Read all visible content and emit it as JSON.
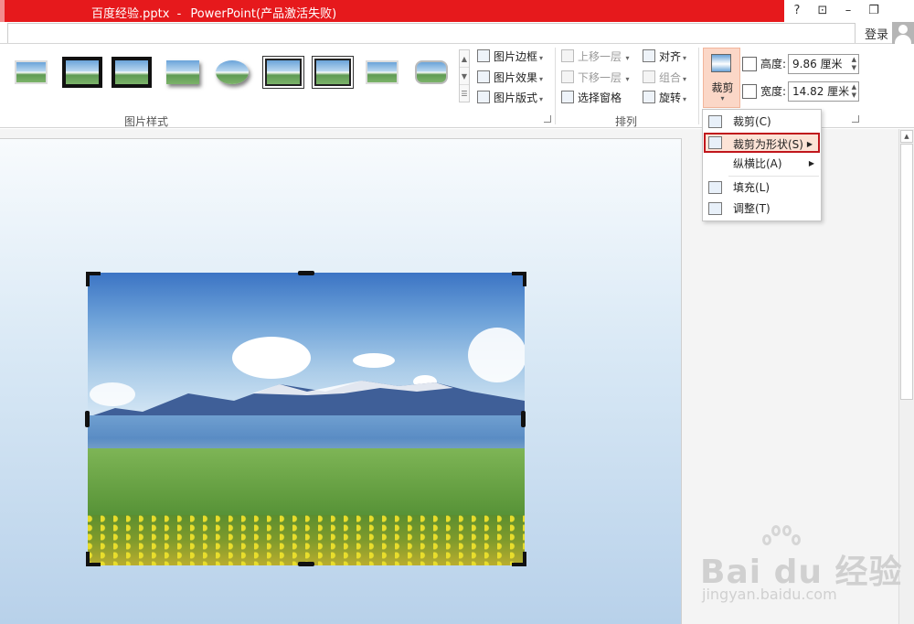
{
  "window": {
    "filename": "百度经验.pptx",
    "separator": "-",
    "app": "PowerPoint(产品激活失败)",
    "help": "?",
    "ribbon_display": "⊡",
    "minimize": "–",
    "restore": "❐",
    "login": "登录"
  },
  "picture_styles": {
    "group_label": "图片样式",
    "commands": {
      "border": "图片边框",
      "effects": "图片效果",
      "layout": "图片版式"
    }
  },
  "arrange": {
    "group_label": "排列",
    "bring_forward": "上移一层",
    "send_backward": "下移一层",
    "selection_pane": "选择窗格",
    "align": "对齐",
    "group": "组合",
    "rotate": "旋转"
  },
  "size": {
    "crop_label": "裁剪",
    "height_label": "高度:",
    "height_value": "9.86 厘米",
    "width_label": "宽度:",
    "width_value": "14.82 厘米"
  },
  "crop_menu": {
    "items": [
      {
        "label": "裁剪(C)",
        "icon": "crop-icon"
      },
      {
        "label": "裁剪为形状(S)",
        "icon": "crop-to-shape-icon",
        "highlighted": true,
        "submenu": true
      },
      {
        "label": "纵横比(A)",
        "icon": "",
        "submenu": true
      },
      {
        "label": "填充(L)",
        "icon": "fill-icon"
      },
      {
        "label": "调整(T)",
        "icon": "fit-icon"
      }
    ]
  },
  "watermark": {
    "brand": "Bai du 经验",
    "url": "jingyan.baidu.com"
  }
}
